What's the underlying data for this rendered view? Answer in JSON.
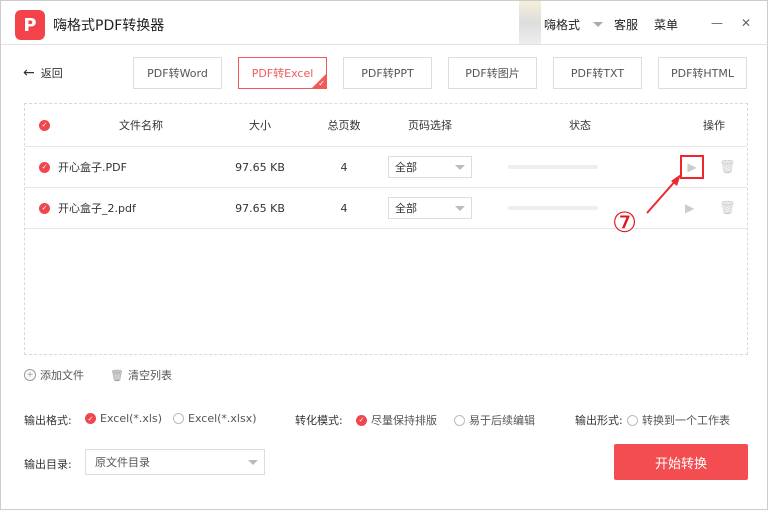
{
  "app": {
    "title": "嗨格式PDF转换器",
    "logo": "P",
    "user": "嗨格式",
    "service": "客服",
    "menu": "菜单",
    "minimize": "—",
    "close": "✕"
  },
  "back": "返回",
  "tabs": [
    "PDF转Word",
    "PDF转Excel",
    "PDF转PPT",
    "PDF转图片",
    "PDF转TXT",
    "PDF转HTML"
  ],
  "active_tab": "PDF转Excel",
  "table": {
    "headers": {
      "name": "文件名称",
      "size": "大小",
      "pages": "总页数",
      "range": "页码选择",
      "status": "状态",
      "action": "操作"
    },
    "rows": [
      {
        "name": "开心盒子.PDF",
        "size": "97.65 KB",
        "pages": "4",
        "range": "全部",
        "progress": 0
      },
      {
        "name": "开心盒子_2.pdf",
        "size": "97.65 KB",
        "pages": "4",
        "range": "全部",
        "progress": 0
      }
    ]
  },
  "annotation": "⑦",
  "add_file": "添加文件",
  "clear_list": "清空列表",
  "options": {
    "format_label": "输出格式:",
    "format_xls": "Excel(*.xls)",
    "format_xlsx": "Excel(*.xlsx)",
    "mode_label": "转化模式:",
    "mode_keep": "尽量保持排版",
    "mode_edit": "易于后续编辑",
    "form_label": "输出形式:",
    "form_one": "转换到一个工作表",
    "dir_label": "输出目录:",
    "dir_value": "原文件目录"
  },
  "start": "开始转换",
  "colors": {
    "accent": "#f44d51"
  }
}
